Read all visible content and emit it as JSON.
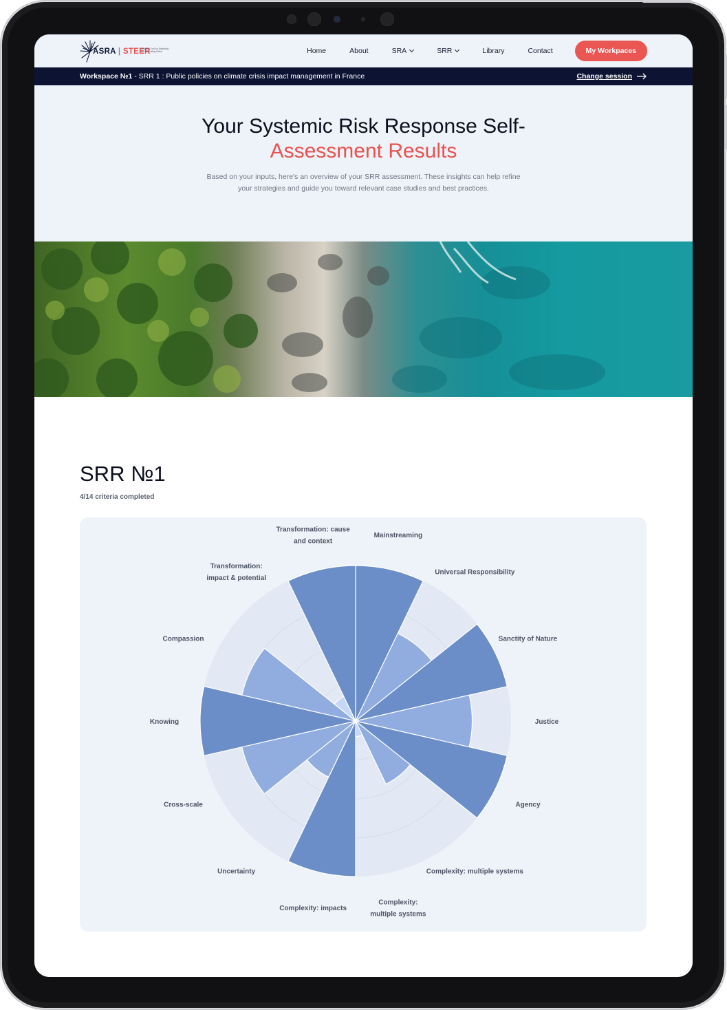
{
  "header": {
    "logo_text_left": "ASRA",
    "logo_text_right": "STEER",
    "logo_subtitle": "Systemic Tool for Exploring and Evaluating Risks",
    "nav": [
      {
        "label": "Home",
        "has_dropdown": false
      },
      {
        "label": "About",
        "has_dropdown": false
      },
      {
        "label": "SRA",
        "has_dropdown": true
      },
      {
        "label": "SRR",
        "has_dropdown": true
      },
      {
        "label": "Library",
        "has_dropdown": false
      },
      {
        "label": "Contact",
        "has_dropdown": false
      }
    ],
    "cta_label": "My Workpaces",
    "cta_color": "#ea5753"
  },
  "session_bar": {
    "workspace": "Workspace №1",
    "separator": " - ",
    "session": "SRR 1 : Public policies on climate crisis impact management in France",
    "change_label": "Change session",
    "change_icon": "arrow-right-icon"
  },
  "hero": {
    "title_line1": "Your Systemic Risk Response Self-",
    "title_line2": "Assessment Results",
    "description": "Based on your inputs, here's an overview of your SRR assessment. These insights can help refine your strategies and guide you toward relevant case studies and best practices."
  },
  "results": {
    "title": "SRR №1",
    "progress": "4/14 criteria completed"
  },
  "chart_data": {
    "type": "polar-area",
    "scale_max": 4,
    "grid_levels": 4,
    "start_angle_deg": 0,
    "direction": "clockwise",
    "colors": {
      "dark": "#6b8ec8",
      "light": "#91ade0",
      "center": "#c6d8f7",
      "ring": "#e3e9f4"
    },
    "sectors": [
      {
        "label": "Mainstreaming",
        "value": 4.0,
        "shade": "dark"
      },
      {
        "label": "Universal Responsibility",
        "value": 2.5,
        "shade": "light"
      },
      {
        "label": "Sanctity of Nature",
        "value": 4.0,
        "shade": "dark"
      },
      {
        "label": "Justice",
        "value": 3.0,
        "shade": "light"
      },
      {
        "label": "Agency",
        "value": 4.0,
        "shade": "dark"
      },
      {
        "label": "Complexity: multiple systems",
        "value": 1.8,
        "shade": "light"
      },
      {
        "label": "Complexity: multiple systems",
        "value": 0.4,
        "shade": "center"
      },
      {
        "label": "Complexity: impacts",
        "value": 4.0,
        "shade": "dark"
      },
      {
        "label": "Uncertainty",
        "value": 1.6,
        "shade": "light"
      },
      {
        "label": "Cross-scale",
        "value": 3.0,
        "shade": "light"
      },
      {
        "label": "Knowing",
        "value": 4.0,
        "shade": "dark"
      },
      {
        "label": "Compassion",
        "value": 3.0,
        "shade": "light"
      },
      {
        "label": "Transformation: impact & potential",
        "value": 0.7,
        "shade": "center"
      },
      {
        "label": "Transformation: cause and context",
        "value": 4.0,
        "shade": "dark"
      }
    ],
    "labels": [
      {
        "lines": [
          "Mainstreaming"
        ]
      },
      {
        "lines": [
          "Universal Responsibility"
        ]
      },
      {
        "lines": [
          "Sanctity of Nature"
        ]
      },
      {
        "lines": [
          "Justice"
        ]
      },
      {
        "lines": [
          "Agency"
        ]
      },
      {
        "lines": [
          "Complexity: multiple systems"
        ]
      },
      {
        "lines": [
          "Complexity:",
          "multiple systems"
        ]
      },
      {
        "lines": [
          "Complexity: impacts"
        ]
      },
      {
        "lines": [
          "Uncertainty"
        ]
      },
      {
        "lines": [
          "Cross-scale"
        ]
      },
      {
        "lines": [
          "Knowing"
        ]
      },
      {
        "lines": [
          "Compassion"
        ]
      },
      {
        "lines": [
          "Transformation:",
          "impact & potential"
        ]
      },
      {
        "lines": [
          "Transformation: cause",
          "and context"
        ]
      }
    ]
  }
}
